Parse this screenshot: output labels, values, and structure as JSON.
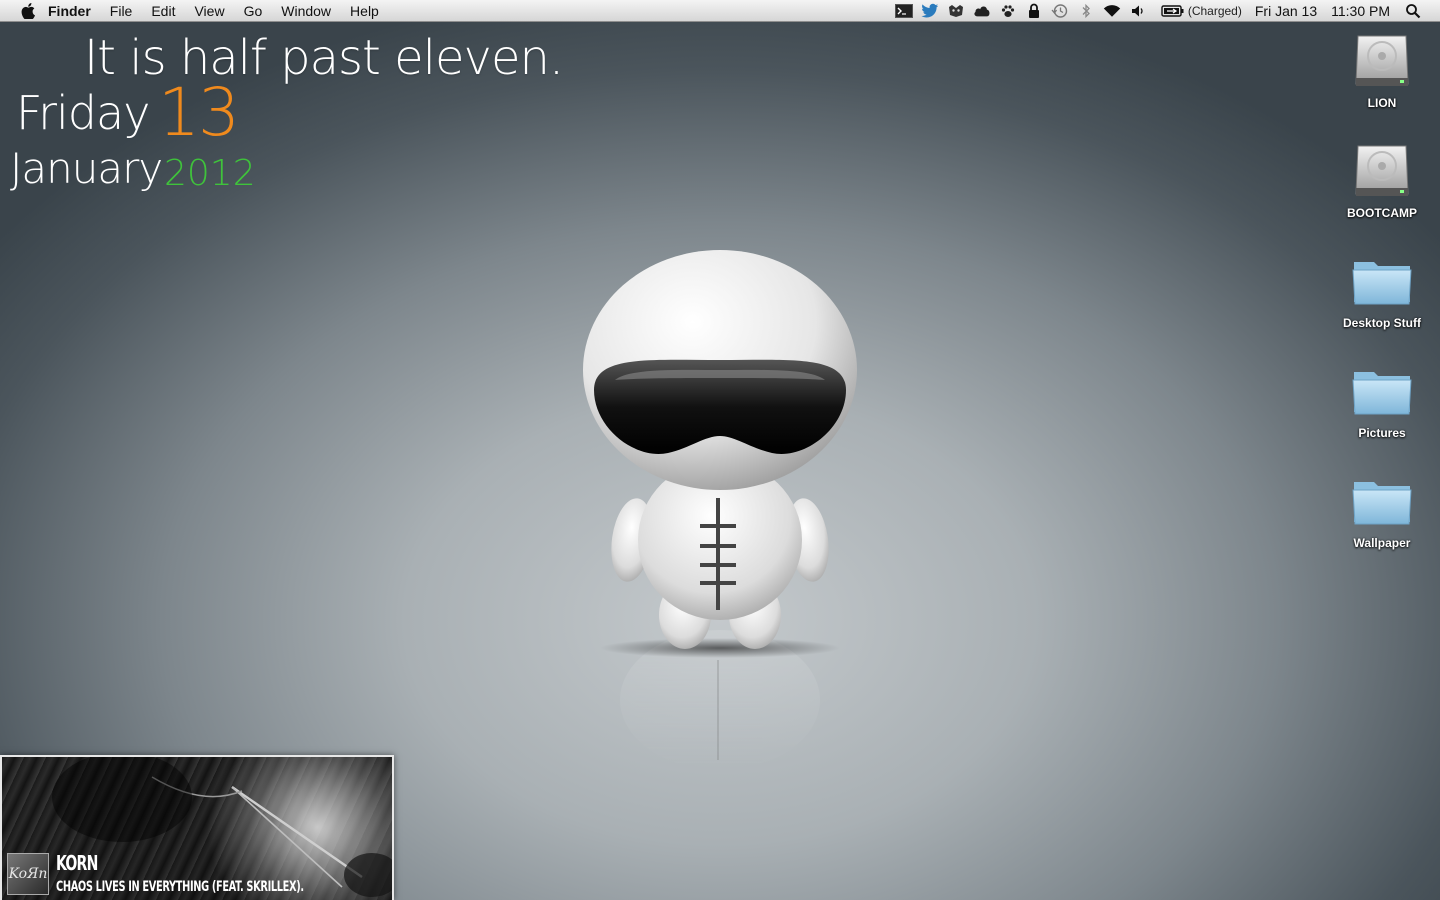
{
  "menubar": {
    "app_name": "Finder",
    "menus": [
      "File",
      "Edit",
      "View",
      "Go",
      "Window",
      "Help"
    ],
    "status_icons": [
      "terminal-icon",
      "twitter-bird-icon",
      "growl-paw-icon",
      "cloud-icon",
      "paw-icon",
      "lock-icon",
      "time-machine-icon",
      "bluetooth-icon",
      "wifi-icon",
      "volume-icon",
      "battery-icon"
    ],
    "battery_text": "(Charged)",
    "date": "Fri Jan 13",
    "time": "11:30 PM"
  },
  "clock_widget": {
    "sentence": "It is half past eleven.",
    "day_name": "Friday",
    "day_number": "13",
    "month": "January",
    "year": "2012",
    "colors": {
      "day_number": "#f08a1d",
      "year": "#3fc33b"
    }
  },
  "desktop_icons": [
    {
      "label": "LION",
      "icon": "hard-drive-icon"
    },
    {
      "label": "BOOTCAMP",
      "icon": "hard-drive-icon"
    },
    {
      "label": "Desktop Stuff",
      "icon": "folder-icon"
    },
    {
      "label": "Pictures",
      "icon": "folder-icon"
    },
    {
      "label": "Wallpaper",
      "icon": "folder-icon"
    }
  ],
  "now_playing": {
    "album_art_text": "KoЯn",
    "artist": "KORN",
    "track": "CHAOS LIVES IN EVERYTHING (FEAT. SKRILLEX)."
  }
}
